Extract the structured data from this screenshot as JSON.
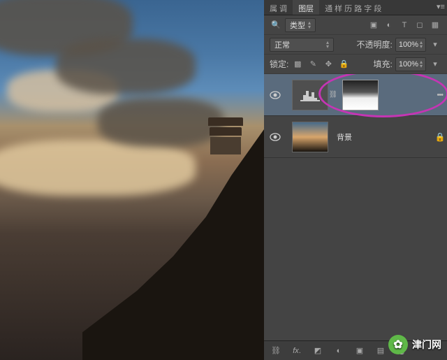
{
  "panel_tabs": {
    "properties": "属 调",
    "layers": "图层",
    "rest": "通 样 历 路 字 段"
  },
  "filter": {
    "label": "类型"
  },
  "blend": {
    "mode": "正常",
    "opacity_label": "不透明度:",
    "opacity_value": "100%"
  },
  "lock": {
    "label": "锁定:",
    "fill_label": "填充:",
    "fill_value": "100%"
  },
  "layers": {
    "adjustment": {
      "name": ""
    },
    "background": {
      "name": "背景"
    }
  },
  "watermark": {
    "text": "津门网"
  }
}
